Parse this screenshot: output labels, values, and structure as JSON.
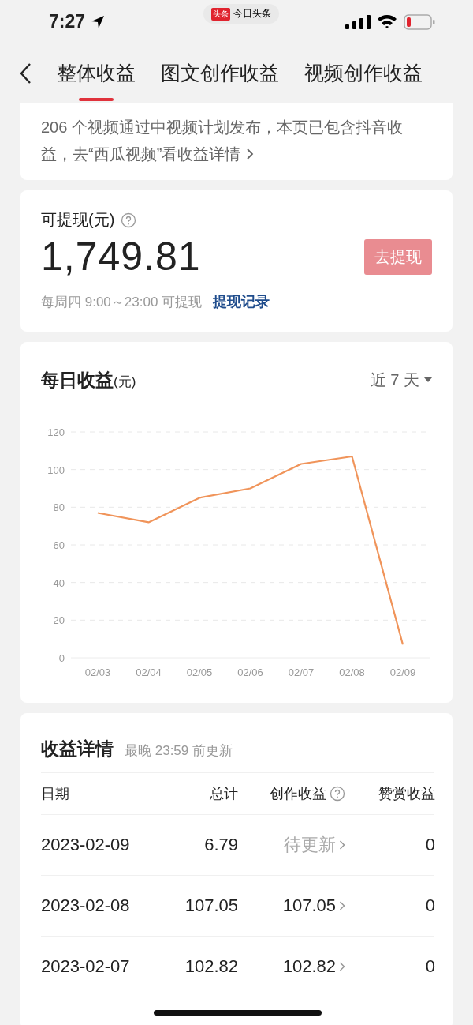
{
  "status_bar": {
    "time": "7:27",
    "back_app": {
      "badge": "头条",
      "name": "今日头条"
    }
  },
  "tabs": [
    {
      "label": "整体收益",
      "selected": true
    },
    {
      "label": "图文创作收益",
      "selected": false
    },
    {
      "label": "视频创作收益",
      "selected": false
    }
  ],
  "notice": {
    "text": "206 个视频通过中视频计划发布，本页已包含抖音收益，去“西瓜视频”看收益详情"
  },
  "withdraw": {
    "label": "可提现(元)",
    "amount": "1,749.81",
    "button": {
      "label": "去提现",
      "disabled": true
    },
    "schedule": "每周四 9:00～23:00 可提现",
    "link": "提现记录"
  },
  "daily": {
    "title": "每日收益",
    "unit": "(元)",
    "range": "近 7 天",
    "chart_data": {
      "type": "line",
      "categories": [
        "02/03",
        "02/04",
        "02/05",
        "02/06",
        "02/07",
        "02/08",
        "02/09"
      ],
      "series": [
        {
          "color": "#f0945a",
          "values": [
            77,
            72,
            85,
            90,
            103,
            107,
            7
          ]
        }
      ],
      "grid": true,
      "ylim": [
        0,
        120
      ],
      "yticks": [
        0,
        20,
        40,
        60,
        80,
        100,
        120
      ]
    }
  },
  "details": {
    "title": "收益详情",
    "note": "最晚 23:59 前更新",
    "columns": [
      {
        "label": "日期",
        "help": false
      },
      {
        "label": "总计",
        "help": false
      },
      {
        "label": "创作收益",
        "help": true
      },
      {
        "label": "赞赏收益",
        "help": false
      }
    ],
    "rows": [
      {
        "date": "2023-02-09",
        "total": "6.79",
        "creation": "待更新",
        "pending": true,
        "reward": "0"
      },
      {
        "date": "2023-02-08",
        "total": "107.05",
        "creation": "107.05",
        "pending": false,
        "reward": "0"
      },
      {
        "date": "2023-02-07",
        "total": "102.82",
        "creation": "102.82",
        "pending": false,
        "reward": "0"
      }
    ]
  }
}
